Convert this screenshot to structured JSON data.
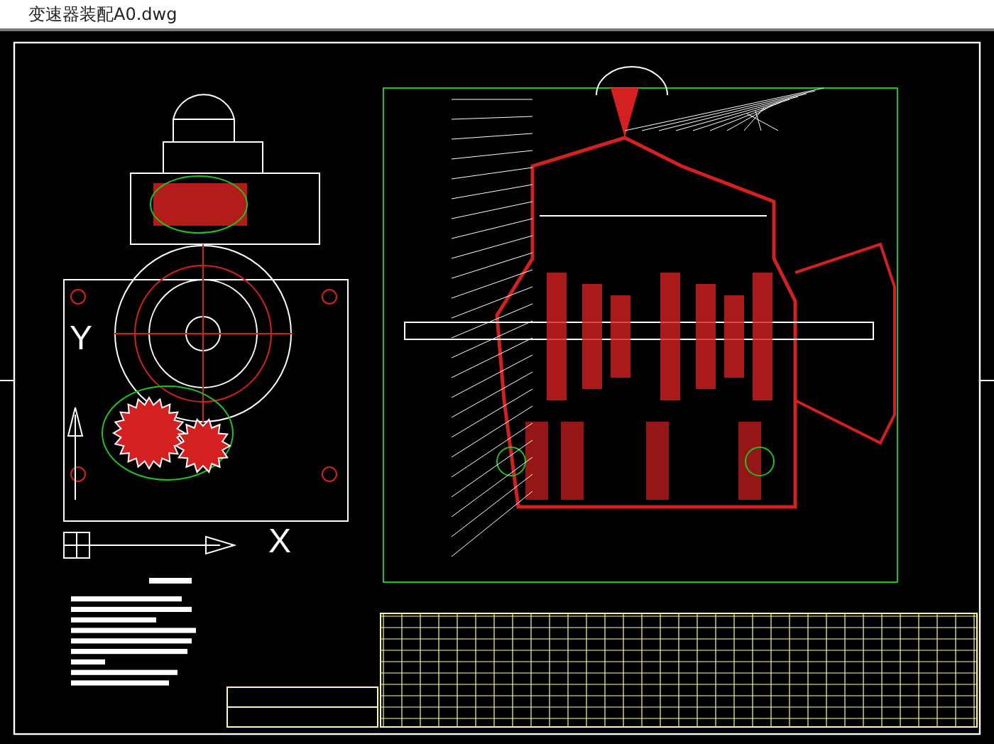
{
  "window": {
    "title": "变速器装配A0.dwg"
  },
  "drawing": {
    "axis_labels": [
      {
        "text": "Y",
        "kind": "vertical"
      },
      {
        "text": "X",
        "kind": "horizontal"
      }
    ]
  }
}
